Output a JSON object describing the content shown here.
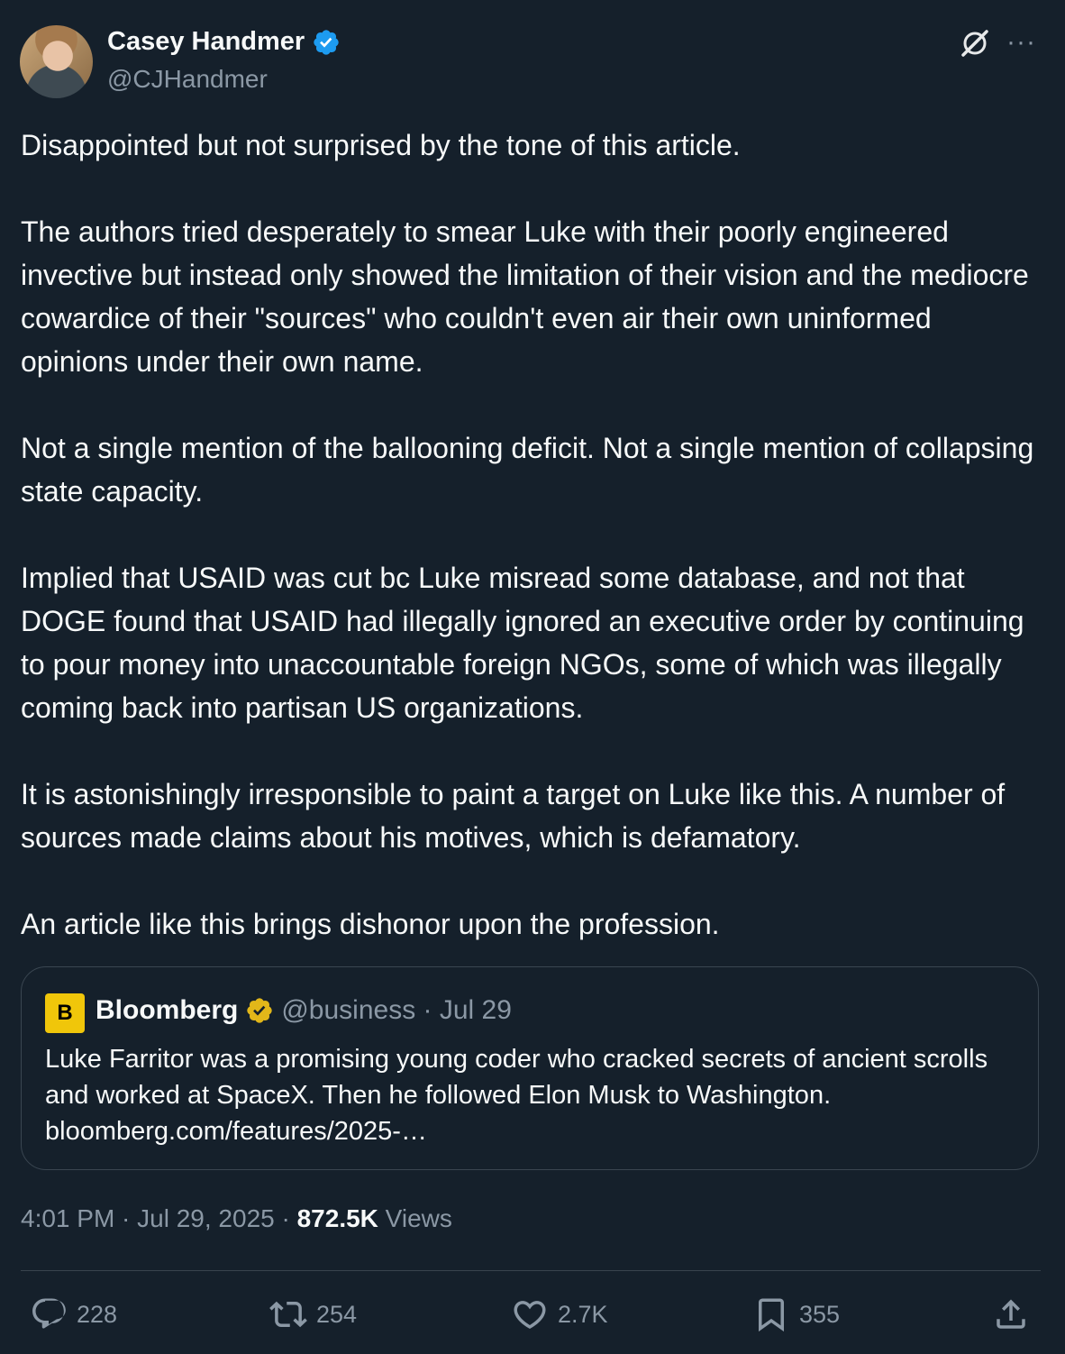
{
  "author": {
    "display_name": "Casey Handmer",
    "handle": "@CJHandmer"
  },
  "body_paragraphs": [
    "Disappointed but not surprised by the tone of this article.",
    "The authors tried desperately to smear Luke with their poorly engineered invective but instead only showed the limitation of their vision and the mediocre cowardice of their \"sources\" who couldn't even air their own uninformed opinions under their own name.",
    "Not a single mention of the ballooning deficit. Not a single mention of collapsing state capacity.",
    "Implied that USAID was cut bc Luke misread some database, and not that DOGE found that USAID had illegally ignored an executive order by continuing to pour money into unaccountable foreign NGOs, some of which was illegally coming back into partisan US organizations.",
    "It is astonishingly irresponsible to paint a target on Luke like this. A number of sources made claims about his motives, which is defamatory.",
    "An article like this brings dishonor upon the profession."
  ],
  "quote": {
    "logo_letter": "B",
    "name": "Bloomberg",
    "handle_date": "@business · Jul 29",
    "text": "Luke Farritor was a promising young coder who cracked secrets of ancient scrolls and worked at SpaceX. Then he followed Elon Musk to Washington. bloomberg.com/features/2025-…"
  },
  "meta": {
    "time_date": "4:01 PM · Jul 29, 2025 · ",
    "views_count": "872.5K",
    "views_label": " Views"
  },
  "actions": {
    "replies": "228",
    "reposts": "254",
    "likes": "2.7K",
    "bookmarks": "355"
  },
  "colors": {
    "background": "#15202b",
    "verified_blue": "#1d9bf0",
    "verified_gold": "#e2b719",
    "muted": "#8b98a5"
  },
  "icons": [
    "verified-badge-icon",
    "grok-icon",
    "more-icon",
    "reply-icon",
    "repost-icon",
    "like-icon",
    "bookmark-icon",
    "share-icon"
  ]
}
